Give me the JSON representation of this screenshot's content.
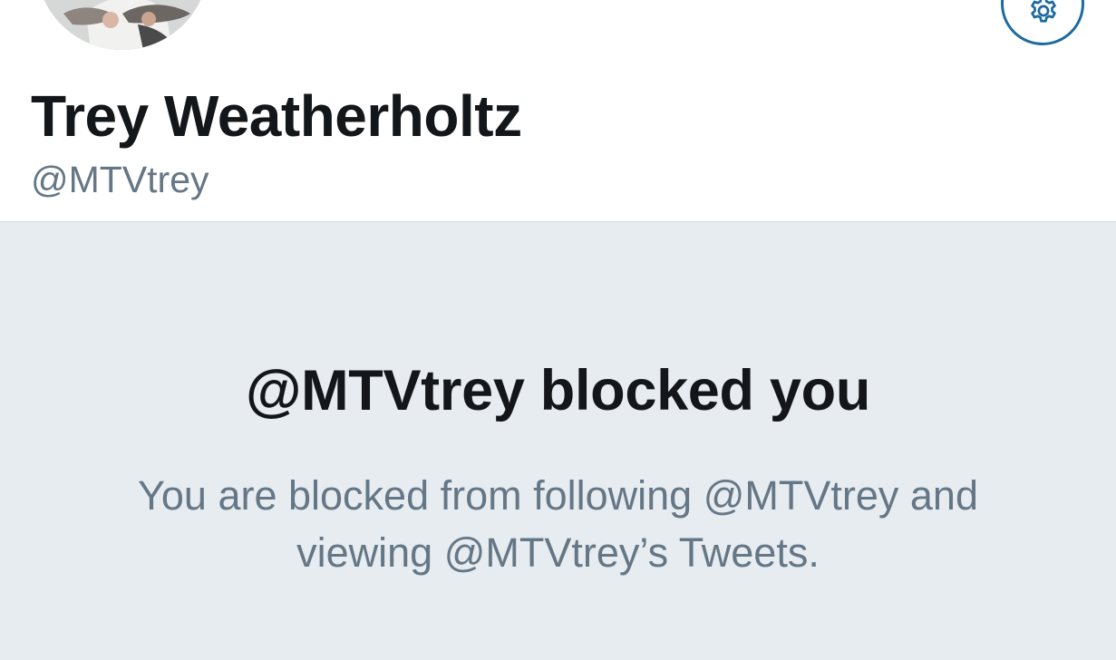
{
  "profile": {
    "display_name": "Trey Weatherholtz",
    "handle": "@MTVtrey"
  },
  "header": {
    "settings_icon": "gear-icon",
    "accent_color": "#1d6aa0"
  },
  "blocked_notice": {
    "title": "@MTVtrey blocked you",
    "message_line_1": "You are blocked from following @MTVtrey and",
    "message_line_2": "viewing @MTVtrey’s Tweets."
  },
  "colors": {
    "panel_background": "#e6ecf0",
    "primary_text": "#14171a",
    "secondary_text": "#657786"
  }
}
